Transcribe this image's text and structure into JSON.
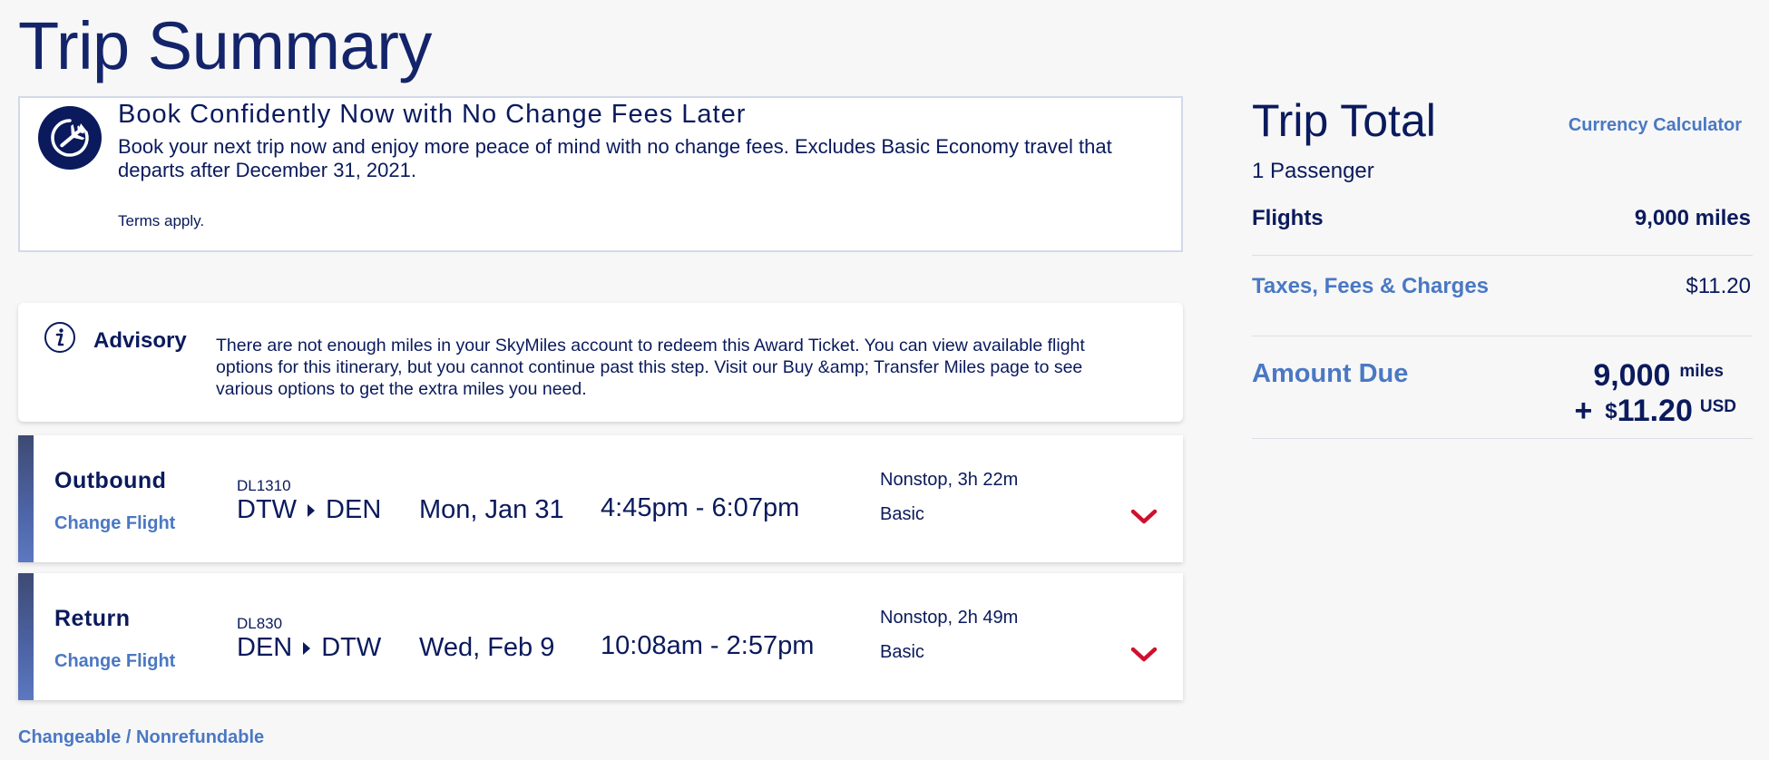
{
  "page": {
    "title": "Trip Summary"
  },
  "promo": {
    "icon": "plane-circle-icon",
    "title": "Book Confidently Now with No Change Fees Later",
    "body": "Book your next trip now and enjoy more peace of mind with no change fees. Excludes Basic Economy travel that departs after December 31, 2021.",
    "terms": "Terms apply."
  },
  "advisory": {
    "icon": "info-icon",
    "title": "Advisory",
    "text": "There are not enough miles in your SkyMiles account to redeem this Award Ticket. You can view available flight options for this itinerary, but you cannot continue past this step. Visit our Buy &amp; Transfer Miles page to see various options to get the extra miles you need."
  },
  "flights": [
    {
      "direction": "Outbound",
      "change_label": "Change Flight",
      "flight_number": "DL1310",
      "origin": "DTW",
      "destination": "DEN",
      "date": "Mon, Jan 31",
      "time": "4:45pm - 6:07pm",
      "stops_duration": "Nonstop, 3h 22m",
      "cabin": "Basic"
    },
    {
      "direction": "Return",
      "change_label": "Change Flight",
      "flight_number": "DL830",
      "origin": "DEN",
      "destination": "DTW",
      "date": "Wed, Feb 9",
      "time": "10:08am - 2:57pm",
      "stops_duration": "Nonstop, 2h 49m",
      "cabin": "Basic"
    }
  ],
  "fare_rule": "Changeable / Nonrefundable",
  "trip_total": {
    "title": "Trip Total",
    "currency_link": "Currency Calculator",
    "passengers": "1 Passenger",
    "flights_label": "Flights",
    "flights_value": "9,000 miles",
    "taxes_label": "Taxes, Fees & Charges",
    "taxes_value": "$11.20",
    "amount_due_label": "Amount Due",
    "amount_miles": "9,000",
    "miles_unit": "miles",
    "plus": "+",
    "dollar_sign": "$",
    "amount_usd": "11.20",
    "usd_unit": "USD"
  },
  "colors": {
    "navy": "#0a1a5c",
    "link_blue": "#4a78c4",
    "chevron_red": "#d0102e",
    "background": "#f7f7f7"
  }
}
